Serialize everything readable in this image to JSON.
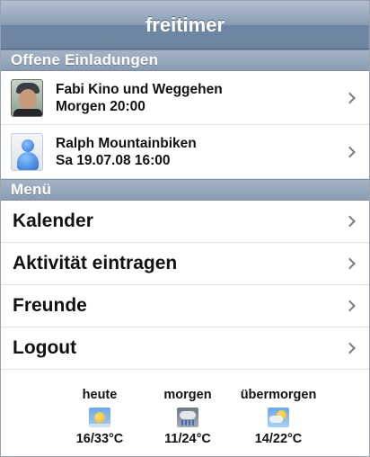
{
  "app": {
    "title": "freitimer"
  },
  "invitations": {
    "header": "Offene Einladungen",
    "items": [
      {
        "title": "Fabi Kino und Weggehen",
        "when": "Morgen 20:00",
        "avatar": "user-photo"
      },
      {
        "title": "Ralph Mountainbiken",
        "when": "Sa 19.07.08 16:00",
        "avatar": "generic-user-icon"
      }
    ]
  },
  "menu": {
    "header": "Menü",
    "items": [
      {
        "label": "Kalender"
      },
      {
        "label": "Aktivität eintragen"
      },
      {
        "label": "Freunde"
      },
      {
        "label": "Logout"
      }
    ]
  },
  "weather": [
    {
      "day": "heute",
      "temp": "16/33°C",
      "icon": "sunny-icon"
    },
    {
      "day": "morgen",
      "temp": "11/24°C",
      "icon": "rain-cloud-icon"
    },
    {
      "day": "übermorgen",
      "temp": "14/22°C",
      "icon": "partly-cloudy-icon"
    }
  ]
}
